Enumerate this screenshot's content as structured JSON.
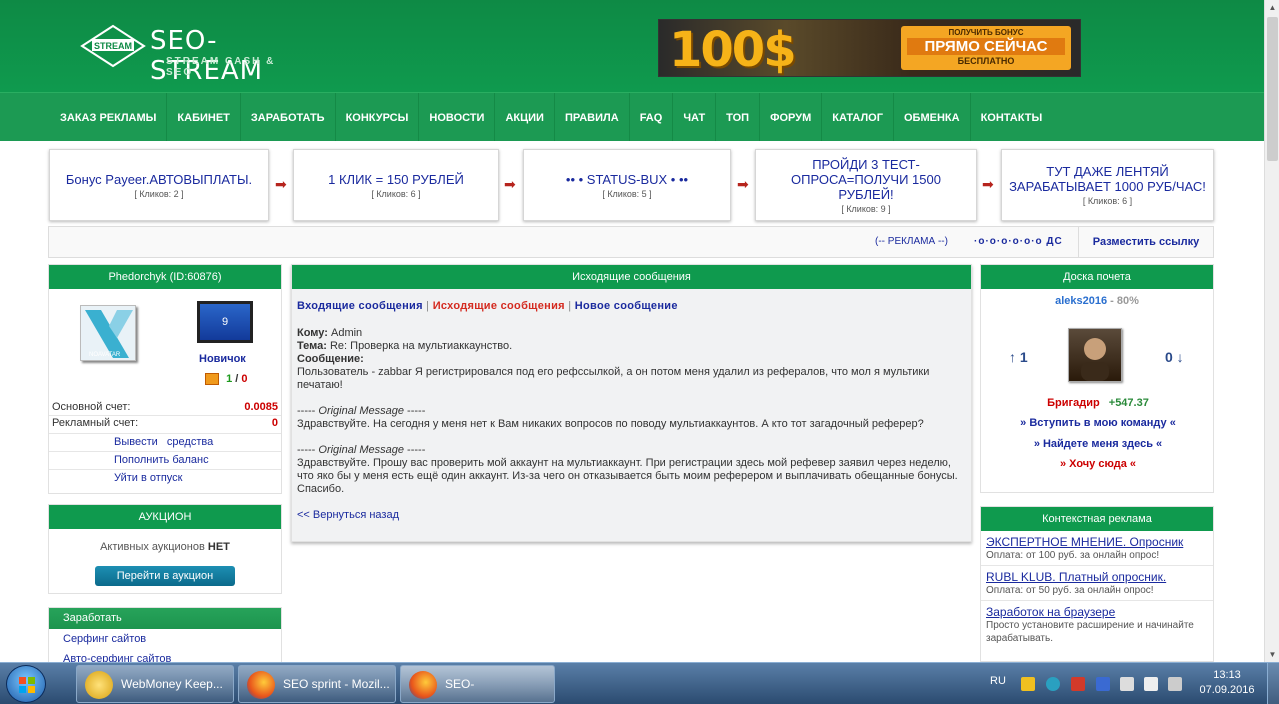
{
  "header": {
    "logo_badge": "STREAM",
    "logo_title": "SEO-STREAM",
    "logo_sub": "STREAM CASH & SEO",
    "banner": {
      "big": "100$",
      "line1": "ПОЛУЧИТЬ БОНУС",
      "line2": "ПРЯМО СЕЙЧАС",
      "line3": "БЕСПЛАТНО"
    }
  },
  "nav": [
    "ЗАКАЗ РЕКЛАМЫ",
    "КАБИНЕТ",
    "ЗАРАБОТАТЬ",
    "КОНКУРСЫ",
    "НОВОСТИ",
    "АКЦИИ",
    "ПРАВИЛА",
    "FAQ",
    "ЧАТ",
    "ТОП",
    "ФОРУМ",
    "КАТАЛОГ",
    "ОБМЕНКА",
    "КОНТАКТЫ"
  ],
  "ads": [
    {
      "text": "Бонус Payeer.АВТОВЫПЛАТЫ.",
      "clicks": "[ Кликов: 2 ]"
    },
    {
      "text": "1 КЛИК = 150 РУБЛЕЙ",
      "clicks": "[ Кликов: 6 ]"
    },
    {
      "text": "•• • STATUS-BUX • ••",
      "clicks": "[ Кликов: 5 ]"
    },
    {
      "text": "ПРОЙДИ 3 ТЕСТ-ОПРОСА=ПОЛУЧИ 1500 РУБЛЕЙ!",
      "clicks": "[ Кликов: 9 ]"
    },
    {
      "text": "ТУТ ДАЖЕ ЛЕНТЯЙ ЗАРАБАТЫВАЕТ 1000 РУБ/ЧАС!",
      "clicks": "[ Кликов: 6 ]"
    }
  ],
  "ticker": {
    "label": "(-- РЕКЛАМА --)",
    "dots": "·o·o·o·o·o·o ДС",
    "place_link": "Разместить ссылку"
  },
  "user": {
    "header": "Phedorchyk (ID:60876)",
    "avatar_label": "NOAVATAR",
    "level": "9",
    "rank": "Новичок",
    "score_good": "1",
    "score_sep": "/",
    "score_bad": "0",
    "main_label": "Основной счет:",
    "main_value": "0.0085",
    "ad_label": "Рекламный счет:",
    "ad_value": "0",
    "links": [
      "Вывести   средства",
      "Пополнить баланс",
      "Уйти в отпуск"
    ]
  },
  "auction": {
    "header": "АУКЦИОН",
    "text": "Активных аукционов",
    "status": "НЕТ",
    "button": "Перейти в аукцион"
  },
  "earn": {
    "header": "Заработать",
    "items": [
      "Серфинг сайтов",
      "Авто-серфинг сайтов"
    ]
  },
  "messages": {
    "header": "Исходящие сообщения",
    "tab_in": "Входящие сообщения",
    "tab_out": "Исходящие сообщения",
    "tab_new": "Новое сообщение",
    "sep": "|",
    "to_label": "Кому:",
    "to_value": "Admin",
    "subject_label": "Тема:",
    "subject_value": "Re: Проверка на мультиаккаунство.",
    "message_label": "Сообщение:",
    "body1": "Пользователь - zabbar Я регистрировался под его рефссылкой, а он потом меня удалил из рефералов, что мол я мультики печатаю!",
    "orig_dash": "-----",
    "orig_label": "Original Message",
    "body2": "Здравствуйте. На сегодня у меня нет к Вам никаких вопросов по поводу мультиаккаунтов. А кто тот загадочный реферер?",
    "body3": "Здравствуйте. Прошу вас проверить мой аккаунт на мультиаккаунт. При регистрации здесь мой рефевер заявил через неделю, что яко бы у меня есть ещё один аккаунт. Из-за чего он отказывается быть моим реферером и выплачивать обещанные бонусы. Спасибо.",
    "back": "<< Вернуться назад"
  },
  "honor": {
    "header": "Доска почета",
    "name": "aleks2016",
    "percent": "- 80%",
    "up": "↑ 1",
    "down": "0 ↓",
    "rank": "Бригадир",
    "amount": "+547.37",
    "link1": "» Вступить в мою команду «",
    "link2": "» Найдете меня здесь «",
    "link3": "» Хочу сюда «"
  },
  "context": {
    "header": "Контекстная реклама",
    "items": [
      {
        "title": "ЭКСПЕРТНОЕ МНЕНИЕ. Опросник",
        "desc": "Оплата: от 100 руб. за онлайн опрос!"
      },
      {
        "title": "RUBL KLUB. Платный опросник.",
        "desc": "Оплата: от 50 руб. за онлайн опрос!"
      },
      {
        "title": "Заработок на браузере",
        "desc": "Просто установите расширение и начинайте зарабатывать."
      }
    ]
  },
  "taskbar": {
    "tasks": [
      "WebMoney Keep...",
      "SEO sprint - Mozil...",
      "SEO-STREAM.CO..."
    ],
    "lang": "RU",
    "time": "13:13",
    "date": "07.09.2016"
  },
  "colors": {
    "brand_green": "#0f9a4e",
    "link_blue": "#1a2a9e",
    "alert_red": "#d42a1f"
  }
}
